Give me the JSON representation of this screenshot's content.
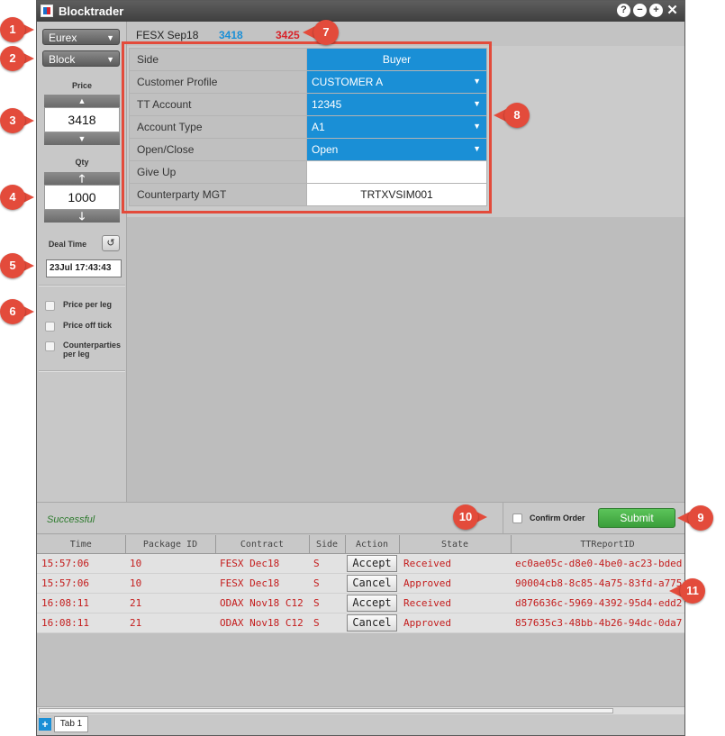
{
  "app": {
    "title": "Blocktrader"
  },
  "titlebar_icons": [
    "help-icon",
    "minimize-icon",
    "maximize-icon",
    "close-icon"
  ],
  "left": {
    "exchange": "Eurex",
    "block_type": "Block",
    "price_label": "Price",
    "price_value": "3418",
    "qty_label": "Qty",
    "qty_value": "1000",
    "deal_time_label": "Deal Time",
    "deal_time_value": "23Jul 17:43:43",
    "options": [
      "Price per leg",
      "Price off tick",
      "Counterparties per leg"
    ]
  },
  "header": {
    "instrument": "FESX Sep18",
    "bid": "3418",
    "ask": "3425"
  },
  "fields": [
    {
      "label": "Side",
      "value": "Buyer"
    },
    {
      "label": "Customer Profile",
      "value": "CUSTOMER A"
    },
    {
      "label": "TT Account",
      "value": "12345"
    },
    {
      "label": "Account Type",
      "value": "A1"
    },
    {
      "label": "Open/Close",
      "value": "Open"
    },
    {
      "label": "Give Up",
      "value": ""
    },
    {
      "label": "Counterparty MGT",
      "value": "TRTXVSIM001"
    }
  ],
  "status": {
    "message": "Successful",
    "confirm_label": "Confirm Order",
    "submit_label": "Submit"
  },
  "grid": {
    "columns": [
      "Time",
      "Package ID",
      "Contract",
      "Side",
      "Action",
      "State",
      "TTReportID"
    ],
    "rows": [
      {
        "time": "15:57:06",
        "package_id": "10",
        "contract": "FESX Dec18",
        "side": "S",
        "action": "Accept",
        "state": "Received",
        "report_id": "ec0ae05c-d8e0-4be0-ac23-bded"
      },
      {
        "time": "15:57:06",
        "package_id": "10",
        "contract": "FESX Dec18",
        "side": "S",
        "action": "Cancel",
        "state": "Approved",
        "report_id": "90004cb8-8c85-4a75-83fd-a775"
      },
      {
        "time": "16:08:11",
        "package_id": "21",
        "contract": "ODAX Nov18 C12",
        "side": "S",
        "action": "Accept",
        "state": "Received",
        "report_id": "d876636c-5969-4392-95d4-edd2"
      },
      {
        "time": "16:08:11",
        "package_id": "21",
        "contract": "ODAX Nov18 C12",
        "side": "S",
        "action": "Cancel",
        "state": "Approved",
        "report_id": "857635c3-48bb-4b26-94dc-0da7"
      }
    ]
  },
  "tabs": [
    "Tab 1"
  ],
  "callouts": [
    "1",
    "2",
    "3",
    "4",
    "5",
    "6",
    "7",
    "8",
    "9",
    "10",
    "11"
  ],
  "colors": {
    "accent_blue": "#1a8fd6",
    "ask_red": "#d8232a",
    "callout_red": "#e34b3b",
    "submit_green": "#4bb34a",
    "grid_text_red": "#c41c1c"
  }
}
